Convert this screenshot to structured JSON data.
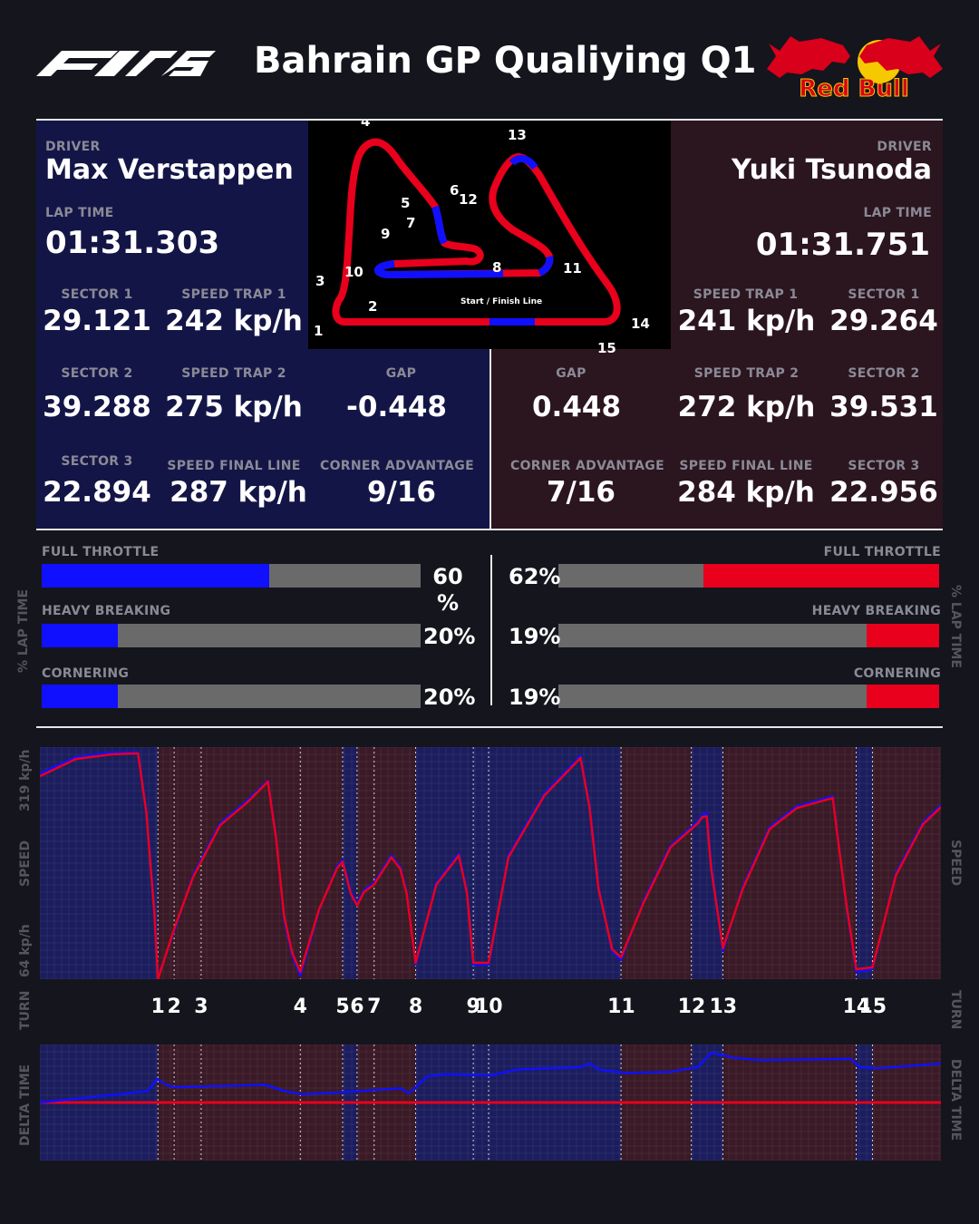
{
  "header": {
    "title": "Bahrain GP Qualiying Q1",
    "series_logo_text": "F1 75",
    "team_logo_text": "Red Bull"
  },
  "colors": {
    "background": "#15151e",
    "driver1": "#1010ff",
    "driver2": "#e8001c",
    "driver1_panel": "#141547",
    "driver2_panel": "#2b151f",
    "bar_track": "#6a6a6a"
  },
  "labels": {
    "driver": "DRIVER",
    "lap_time": "LAP TIME",
    "sector1": "SECTOR 1",
    "sector2": "SECTOR 2",
    "sector3": "SECTOR 3",
    "speed_trap1": "SPEED TRAP 1",
    "speed_trap2": "SPEED TRAP 2",
    "speed_final_line": "SPEED FINAL LINE",
    "gap": "GAP",
    "corner_advantage": "CORNER ADVANTAGE",
    "full_throttle": "FULL THROTTLE",
    "heavy_breaking": "HEAVY BREAKING",
    "cornering": "CORNERING",
    "pct_lap_time": "% LAP TIME",
    "speed": "SPEED",
    "turn": "TURN",
    "delta_time": "DELTA TIME",
    "speed_max": "319 kp/h",
    "speed_min": "64 kp/h",
    "start_finish": "Start / Finish Line"
  },
  "driver1": {
    "name": "Max Verstappen",
    "lap_time": "01:31.303",
    "sector1": "29.121",
    "sector2": "39.288",
    "sector3": "22.894",
    "speed_trap1": "242 kp/h",
    "speed_trap2": "275 kp/h",
    "speed_final_line": "287 kp/h",
    "gap": "-0.448",
    "corner_advantage": "9/16",
    "full_throttle": 60,
    "full_throttle_label_a": "60",
    "full_throttle_label_b": "%",
    "heavy_breaking": 20,
    "heavy_breaking_label": "20%",
    "cornering": 20,
    "cornering_label": "20%"
  },
  "driver2": {
    "name": "Yuki Tsunoda",
    "lap_time": "01:31.751",
    "sector1": "29.264",
    "sector2": "39.531",
    "sector3": "22.956",
    "speed_trap1": "241 kp/h",
    "speed_trap2": "272 kp/h",
    "speed_final_line": "284 kp/h",
    "gap": "0.448",
    "corner_advantage": "7/16",
    "full_throttle": 62,
    "full_throttle_label": "62%",
    "heavy_breaking": 19,
    "heavy_breaking_label": "19%",
    "cornering": 19,
    "cornering_label": "19%"
  },
  "track_map": {
    "corner_labels": [
      "1",
      "2",
      "3",
      "4",
      "5",
      "6",
      "7",
      "8",
      "9",
      "10",
      "11",
      "12",
      "13",
      "14",
      "15"
    ]
  },
  "chart_data": [
    {
      "type": "line",
      "title": "",
      "ylabel": "SPEED",
      "ylim": [
        64,
        319
      ],
      "x_unit": "fraction of lap",
      "grid": true,
      "turns": [
        "1",
        "2",
        "3",
        "4",
        "5",
        "6",
        "7",
        "8",
        "9",
        "10",
        "11",
        "12",
        "13",
        "14",
        "15"
      ],
      "turn_positions": [
        0.131,
        0.149,
        0.179,
        0.289,
        0.336,
        0.352,
        0.371,
        0.417,
        0.481,
        0.498,
        0.645,
        0.723,
        0.758,
        0.906,
        0.924
      ],
      "zones": [
        {
          "from": 0.0,
          "to": 0.131,
          "leader": "driver1"
        },
        {
          "from": 0.131,
          "to": 0.289,
          "leader": "driver2"
        },
        {
          "from": 0.289,
          "to": 0.336,
          "leader": "driver2"
        },
        {
          "from": 0.336,
          "to": 0.352,
          "leader": "driver1"
        },
        {
          "from": 0.352,
          "to": 0.371,
          "leader": "driver2"
        },
        {
          "from": 0.371,
          "to": 0.417,
          "leader": "driver2"
        },
        {
          "from": 0.417,
          "to": 0.645,
          "leader": "driver1"
        },
        {
          "from": 0.645,
          "to": 0.723,
          "leader": "driver2"
        },
        {
          "from": 0.723,
          "to": 0.758,
          "leader": "driver1"
        },
        {
          "from": 0.758,
          "to": 0.906,
          "leader": "driver2"
        },
        {
          "from": 0.906,
          "to": 0.924,
          "leader": "driver1"
        },
        {
          "from": 0.924,
          "to": 1.0,
          "leader": "driver2"
        }
      ],
      "series": [
        {
          "name": "Max Verstappen",
          "x": [
            0,
            0.04,
            0.08,
            0.109,
            0.118,
            0.127,
            0.131,
            0.15,
            0.17,
            0.2,
            0.23,
            0.253,
            0.262,
            0.271,
            0.28,
            0.289,
            0.31,
            0.33,
            0.336,
            0.345,
            0.352,
            0.36,
            0.371,
            0.39,
            0.4,
            0.407,
            0.417,
            0.44,
            0.465,
            0.474,
            0.481,
            0.498,
            0.52,
            0.56,
            0.6,
            0.61,
            0.62,
            0.635,
            0.645,
            0.67,
            0.7,
            0.73,
            0.735,
            0.74,
            0.745,
            0.758,
            0.78,
            0.81,
            0.84,
            0.88,
            0.885,
            0.895,
            0.906,
            0.924,
            0.95,
            0.98,
            1.0
          ],
          "values": [
            290,
            308,
            313,
            313,
            250,
            140,
            66,
            120,
            178,
            235,
            260,
            282,
            222,
            130,
            90,
            68,
            140,
            188,
            195,
            160,
            147,
            162,
            170,
            200,
            187,
            160,
            80,
            170,
            202,
            160,
            80,
            80,
            200,
            268,
            309,
            255,
            165,
            95,
            85,
            150,
            211,
            237,
            244,
            247,
            190,
            95,
            165,
            231,
            254,
            265,
            225,
            145,
            72,
            75,
            180,
            236,
            255
          ]
        },
        {
          "name": "Yuki Tsunoda",
          "x": [
            0,
            0.04,
            0.08,
            0.109,
            0.118,
            0.127,
            0.131,
            0.15,
            0.17,
            0.2,
            0.23,
            0.253,
            0.262,
            0.271,
            0.28,
            0.289,
            0.31,
            0.33,
            0.336,
            0.345,
            0.352,
            0.36,
            0.371,
            0.39,
            0.4,
            0.407,
            0.417,
            0.44,
            0.465,
            0.474,
            0.481,
            0.498,
            0.52,
            0.56,
            0.6,
            0.61,
            0.62,
            0.635,
            0.645,
            0.67,
            0.7,
            0.73,
            0.735,
            0.74,
            0.745,
            0.758,
            0.78,
            0.81,
            0.84,
            0.88,
            0.885,
            0.895,
            0.906,
            0.924,
            0.95,
            0.98,
            1.0
          ],
          "values": [
            287,
            306,
            311,
            312,
            248,
            138,
            64,
            122,
            176,
            233,
            258,
            281,
            220,
            133,
            93,
            72,
            141,
            186,
            193,
            158,
            145,
            160,
            168,
            198,
            185,
            158,
            82,
            168,
            200,
            158,
            82,
            82,
            198,
            266,
            307,
            253,
            163,
            97,
            88,
            148,
            209,
            235,
            242,
            243,
            186,
            98,
            163,
            229,
            252,
            263,
            223,
            147,
            75,
            77,
            178,
            234,
            253
          ]
        }
      ]
    },
    {
      "type": "line",
      "title": "",
      "ylabel": "DELTA TIME",
      "x_unit": "fraction of lap",
      "grid": true,
      "series": [
        {
          "name": "Max Verstappen",
          "x": [
            0,
            0.05,
            0.1,
            0.12,
            0.13,
            0.14,
            0.15,
            0.2,
            0.25,
            0.27,
            0.29,
            0.32,
            0.36,
            0.4,
            0.41,
            0.42,
            0.43,
            0.45,
            0.5,
            0.53,
            0.6,
            0.61,
            0.62,
            0.65,
            0.7,
            0.73,
            0.745,
            0.76,
            0.77,
            0.8,
            0.9,
            0.91,
            0.93,
            1.0
          ],
          "values": [
            0,
            0.04,
            0.08,
            0.1,
            0.2,
            0.15,
            0.13,
            0.14,
            0.15,
            0.1,
            0.07,
            0.08,
            0.1,
            0.12,
            0.08,
            0.15,
            0.22,
            0.24,
            0.23,
            0.28,
            0.3,
            0.33,
            0.28,
            0.25,
            0.26,
            0.3,
            0.42,
            0.4,
            0.38,
            0.36,
            0.37,
            0.3,
            0.29,
            0.33
          ]
        },
        {
          "name": "Yuki Tsunoda",
          "x": [
            0,
            1.0
          ],
          "values": [
            0,
            0
          ]
        }
      ]
    }
  ]
}
